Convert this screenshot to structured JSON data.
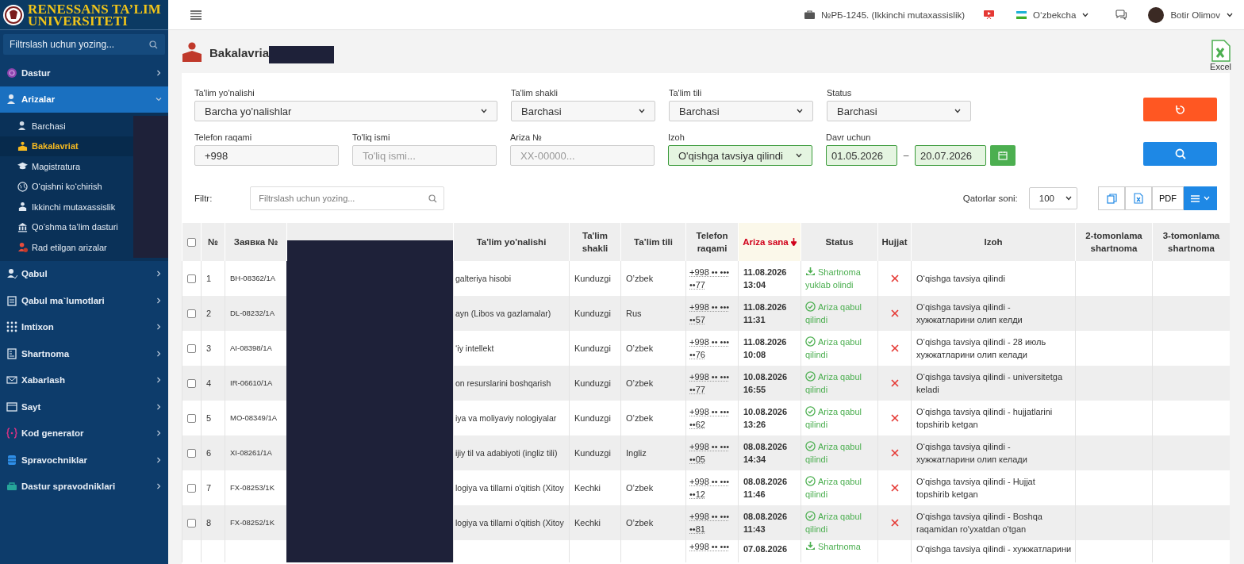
{
  "brand": {
    "line1": "RENESSANS TA’LIM",
    "line2": "UNIVERSITETI"
  },
  "sidebar": {
    "search_placeholder": "Filtrslash uchun yozing...",
    "items": [
      {
        "label": "Dastur",
        "selected": false,
        "expanded": false
      },
      {
        "label": "Arizalar",
        "selected": true,
        "expanded": true,
        "children": [
          {
            "label": "Barchasi",
            "selected": false
          },
          {
            "label": "Bakalavriat",
            "selected": true
          },
          {
            "label": "Magistratura",
            "selected": false
          },
          {
            "label": "O‘qishni ko‘chirish",
            "selected": false
          },
          {
            "label": "Ikkinchi mutaxassislik",
            "selected": false
          },
          {
            "label": "Qo‘shma ta’lim dasturi",
            "selected": false
          },
          {
            "label": "Rad etilgan arizalar",
            "selected": false
          }
        ]
      },
      {
        "label": "Qabul",
        "selected": false,
        "expanded": false
      },
      {
        "label": "Qabul ma`lumotlari",
        "selected": false,
        "expanded": false
      },
      {
        "label": "Imtixon",
        "selected": false,
        "expanded": false
      },
      {
        "label": "Shartnoma",
        "selected": false,
        "expanded": false
      },
      {
        "label": "Xabarlash",
        "selected": false,
        "expanded": false
      },
      {
        "label": "Sayt",
        "selected": false,
        "expanded": false
      },
      {
        "label": "Kod generator",
        "selected": false,
        "expanded": false
      },
      {
        "label": "Spravochniklar",
        "selected": false,
        "expanded": false
      },
      {
        "label": "Dastur spravodniklari",
        "selected": false,
        "expanded": false
      }
    ]
  },
  "topbar": {
    "organization": "№РБ-1245. (Ikkinchi mutaxassislik)",
    "language": "O‘zbekcha",
    "user": "Botir Olimov"
  },
  "page": {
    "title": "Bakalavria",
    "export_label": "Excel"
  },
  "filters": {
    "row1": [
      {
        "label": "Ta'lim yo'nalishi",
        "value": "Barcha yo'nalishlar",
        "kind": "select",
        "highlighted": false
      },
      {
        "label": "Ta'lim shakli",
        "value": "Barchasi",
        "kind": "select",
        "highlighted": false
      },
      {
        "label": "Ta'lim tili",
        "value": "Barchasi",
        "kind": "select",
        "highlighted": false
      },
      {
        "label": "Status",
        "value": "Barchasi",
        "kind": "select",
        "highlighted": false
      }
    ],
    "row2": [
      {
        "label": "Telefon raqami",
        "value": "+998",
        "kind": "input",
        "highlighted": false
      },
      {
        "label": "To'liq ismi",
        "placeholder": "To'liq ismi...",
        "kind": "input",
        "highlighted": false
      },
      {
        "label": "Ariza №",
        "placeholder": "XX-00000...",
        "kind": "input",
        "highlighted": false
      },
      {
        "label": "Izoh",
        "value": "O'qishga tavsiya qilindi",
        "kind": "select",
        "highlighted": true
      }
    ],
    "period": {
      "label": "Davr uchun",
      "from": "01.05.2026",
      "separator": "–",
      "to": "20.07.2026",
      "highlighted": true
    }
  },
  "toolbar": {
    "filter_label": "Filtr:",
    "filter_placeholder": "Filtrslash uchun yozing...",
    "rows_label": "Qatorlar soni:",
    "rows_value": "100",
    "pdf_label": "PDF"
  },
  "table": {
    "select_all_checked": false,
    "columns": [
      {
        "label": "№",
        "sorted": false
      },
      {
        "label": "Заявка №",
        "sorted": false
      },
      {
        "label": "Ta'lim yo'nalishi",
        "sorted": false
      },
      {
        "label": "Ta'lim shakli",
        "sorted": false
      },
      {
        "label": "Ta’lim tili",
        "sorted": false
      },
      {
        "label": "Telefon raqami",
        "sorted": false
      },
      {
        "label": "Ariza sana",
        "sorted": true
      },
      {
        "label": "Status",
        "sorted": false
      },
      {
        "label": "Hujjat",
        "sorted": false
      },
      {
        "label": "Izoh",
        "sorted": false
      },
      {
        "label": "2-tomonlama shartnoma",
        "sorted": false
      },
      {
        "label": "3-tomonlama shartnoma",
        "sorted": false
      }
    ],
    "rows": [
      {
        "checked": false,
        "number": "1",
        "application": "BH-08362/1A",
        "direction": "galteriya hisobi",
        "form": "Kunduzgi",
        "language": "O’zbek",
        "phone": "+998 •• ••• ••77",
        "date": "11.08.2026 13:04",
        "status": {
          "label": "Shartnoma yuklab olindi",
          "kind": "download"
        },
        "document": false,
        "note": "O‘qishga tavsiya qilindi"
      },
      {
        "checked": false,
        "number": "2",
        "application": "DL-08232/1A",
        "direction": "ayn (Libos va gazlamalar)",
        "form": "Kunduzgi",
        "language": "Rus",
        "phone": "+998 •• ••• ••57",
        "date": "11.08.2026 11:31",
        "status": {
          "label": "Ariza qabul qilindi",
          "kind": "accepted"
        },
        "document": false,
        "note": "O‘qishga tavsiya qilindi - хужжатларини олип келди"
      },
      {
        "checked": false,
        "number": "3",
        "application": "AI-08398/1A",
        "direction": "‘iy intellekt",
        "form": "Kunduzgi",
        "language": "O’zbek",
        "phone": "+998 •• ••• ••76",
        "date": "11.08.2026 10:08",
        "status": {
          "label": "Ariza qabul qilindi",
          "kind": "accepted"
        },
        "document": false,
        "note": "O‘qishga tavsiya qilindi - 28 июль хужжатларини олип келади"
      },
      {
        "checked": false,
        "number": "4",
        "application": "IR-06610/1A",
        "direction": "on resurslarini boshqarish",
        "form": "Kunduzgi",
        "language": "O’zbek",
        "phone": "+998 •• ••• ••77",
        "date": "10.08.2026 16:55",
        "status": {
          "label": "Ariza qabul qilindi",
          "kind": "accepted"
        },
        "document": false,
        "note": "O‘qishga tavsiya qilindi - universitetga keladi"
      },
      {
        "checked": false,
        "number": "5",
        "application": "MO-08349/1A",
        "direction": "iya va moliyaviy nologiyalar",
        "form": "Kunduzgi",
        "language": "O’zbek",
        "phone": "+998 •• ••• ••62",
        "date": "10.08.2026 13:26",
        "status": {
          "label": "Ariza qabul qilindi",
          "kind": "accepted"
        },
        "document": false,
        "note": "O‘qishga tavsiya qilindi - hujjatlarini topshirib ketgan"
      },
      {
        "checked": false,
        "number": "6",
        "application": "XI-08261/1A",
        "direction": "ijiy til va adabiyoti (ingliz tili)",
        "form": "Kunduzgi",
        "language": "Ingliz",
        "phone": "+998 •• ••• ••05",
        "date": "08.08.2026 14:34",
        "status": {
          "label": "Ariza qabul qilindi",
          "kind": "accepted"
        },
        "document": false,
        "note": "O‘qishga tavsiya qilindi - хужжатларини олип келади"
      },
      {
        "checked": false,
        "number": "7",
        "application": "FX-08253/1K",
        "direction": "logiya va tillarni o'qitish (Xitoy",
        "form": "Kechki",
        "language": "O’zbek",
        "phone": "+998 •• ••• ••12",
        "date": "08.08.2026 11:46",
        "status": {
          "label": "Ariza qabul qilindi",
          "kind": "accepted"
        },
        "document": false,
        "note": "O‘qishga tavsiya qilindi - Hujjat topshirib ketgan"
      },
      {
        "checked": false,
        "number": "8",
        "application": "FX-08252/1K",
        "direction": "logiya va tillarni o'qitish (Xitoy",
        "form": "Kechki",
        "language": "O’zbek",
        "phone": "+998 •• ••• ••81",
        "date": "08.08.2026 11:43",
        "status": {
          "label": "Ariza qabul qilindi",
          "kind": "accepted"
        },
        "document": false,
        "note": "O‘qishga tavsiya qilindi - Boshqa raqamidan ro'yxatdan o'tgan"
      },
      {
        "phone": "+998 •• •••",
        "date": "07.08.2026",
        "status": {
          "label": "Shartnoma",
          "kind": "download"
        },
        "note": "O‘qishga tavsiya qilindi - хужжатларини"
      }
    ]
  }
}
